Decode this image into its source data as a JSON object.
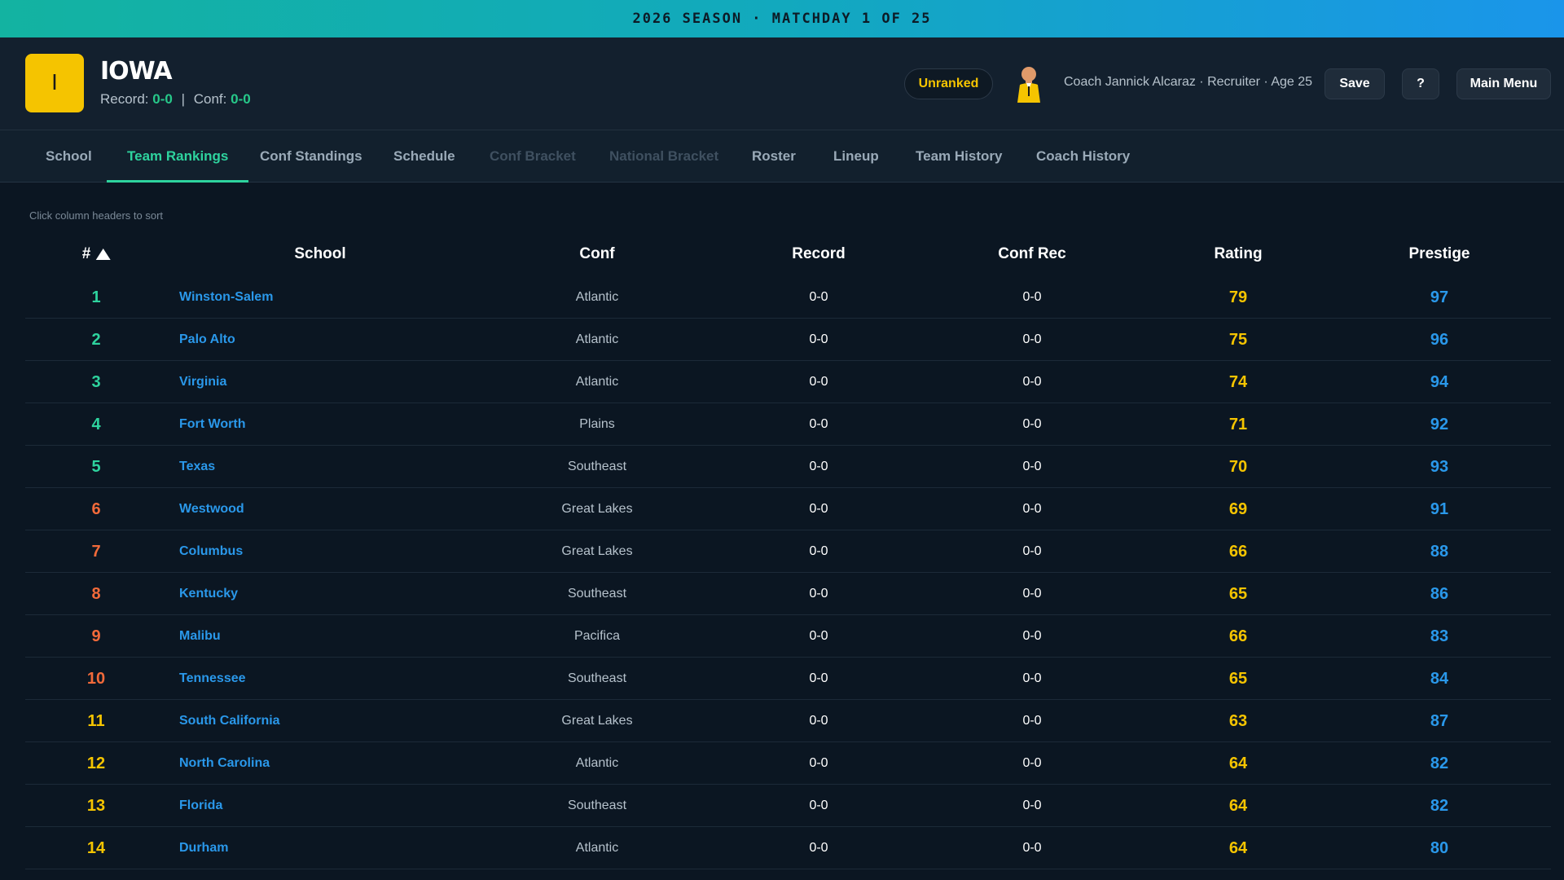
{
  "banner": "2026 SEASON · MATCHDAY 1 OF 25",
  "team": {
    "logo_letter": "I",
    "name": "IOWA",
    "record_label": "Record:",
    "record": "0-0",
    "conf_label": "Conf:",
    "conf": "0-0",
    "separator": "|"
  },
  "rank_badge": "Unranked",
  "coach": "Coach Jannick Alcaraz · Recruiter · Age 25",
  "buttons": {
    "save": "Save",
    "help": "?",
    "main_menu": "Main Menu"
  },
  "tabs": [
    {
      "label": "School",
      "state": "normal"
    },
    {
      "label": "Team Rankings",
      "state": "active"
    },
    {
      "label": "Conf Standings",
      "state": "normal"
    },
    {
      "label": "Schedule",
      "state": "normal"
    },
    {
      "label": "Conf Bracket",
      "state": "disabled"
    },
    {
      "label": "National Bracket",
      "state": "disabled"
    },
    {
      "label": "Roster",
      "state": "normal"
    },
    {
      "label": "Lineup",
      "state": "normal"
    },
    {
      "label": "Team History",
      "state": "normal"
    },
    {
      "label": "Coach History",
      "state": "normal"
    }
  ],
  "hint": "Click column headers to sort",
  "columns": {
    "rank": "#",
    "school": "School",
    "conf": "Conf",
    "record": "Record",
    "conf_rec": "Conf Rec",
    "rating": "Rating",
    "prestige": "Prestige"
  },
  "rows": [
    {
      "rank": "1",
      "school": "Winston-Salem",
      "conf": "Atlantic",
      "record": "0-0",
      "conf_rec": "0-0",
      "rating": "79",
      "prestige": "97",
      "tier": "green"
    },
    {
      "rank": "2",
      "school": "Palo Alto",
      "conf": "Atlantic",
      "record": "0-0",
      "conf_rec": "0-0",
      "rating": "75",
      "prestige": "96",
      "tier": "green"
    },
    {
      "rank": "3",
      "school": "Virginia",
      "conf": "Atlantic",
      "record": "0-0",
      "conf_rec": "0-0",
      "rating": "74",
      "prestige": "94",
      "tier": "green"
    },
    {
      "rank": "4",
      "school": "Fort Worth",
      "conf": "Plains",
      "record": "0-0",
      "conf_rec": "0-0",
      "rating": "71",
      "prestige": "92",
      "tier": "green"
    },
    {
      "rank": "5",
      "school": "Texas",
      "conf": "Southeast",
      "record": "0-0",
      "conf_rec": "0-0",
      "rating": "70",
      "prestige": "93",
      "tier": "green"
    },
    {
      "rank": "6",
      "school": "Westwood",
      "conf": "Great Lakes",
      "record": "0-0",
      "conf_rec": "0-0",
      "rating": "69",
      "prestige": "91",
      "tier": "orange"
    },
    {
      "rank": "7",
      "school": "Columbus",
      "conf": "Great Lakes",
      "record": "0-0",
      "conf_rec": "0-0",
      "rating": "66",
      "prestige": "88",
      "tier": "orange"
    },
    {
      "rank": "8",
      "school": "Kentucky",
      "conf": "Southeast",
      "record": "0-0",
      "conf_rec": "0-0",
      "rating": "65",
      "prestige": "86",
      "tier": "orange"
    },
    {
      "rank": "9",
      "school": "Malibu",
      "conf": "Pacifica",
      "record": "0-0",
      "conf_rec": "0-0",
      "rating": "66",
      "prestige": "83",
      "tier": "orange"
    },
    {
      "rank": "10",
      "school": "Tennessee",
      "conf": "Southeast",
      "record": "0-0",
      "conf_rec": "0-0",
      "rating": "65",
      "prestige": "84",
      "tier": "orange"
    },
    {
      "rank": "11",
      "school": "South California",
      "conf": "Great Lakes",
      "record": "0-0",
      "conf_rec": "0-0",
      "rating": "63",
      "prestige": "87",
      "tier": "yellow"
    },
    {
      "rank": "12",
      "school": "North Carolina",
      "conf": "Atlantic",
      "record": "0-0",
      "conf_rec": "0-0",
      "rating": "64",
      "prestige": "82",
      "tier": "yellow"
    },
    {
      "rank": "13",
      "school": "Florida",
      "conf": "Southeast",
      "record": "0-0",
      "conf_rec": "0-0",
      "rating": "64",
      "prestige": "82",
      "tier": "yellow"
    },
    {
      "rank": "14",
      "school": "Durham",
      "conf": "Atlantic",
      "record": "0-0",
      "conf_rec": "0-0",
      "rating": "64",
      "prestige": "80",
      "tier": "yellow"
    }
  ],
  "colors": {
    "accent": "#2ed39e",
    "rating": "#f5c400",
    "prestige": "#2a98ea",
    "tier_green": "#2ed39e",
    "tier_orange": "#f26a3a",
    "tier_yellow": "#f5c400"
  }
}
